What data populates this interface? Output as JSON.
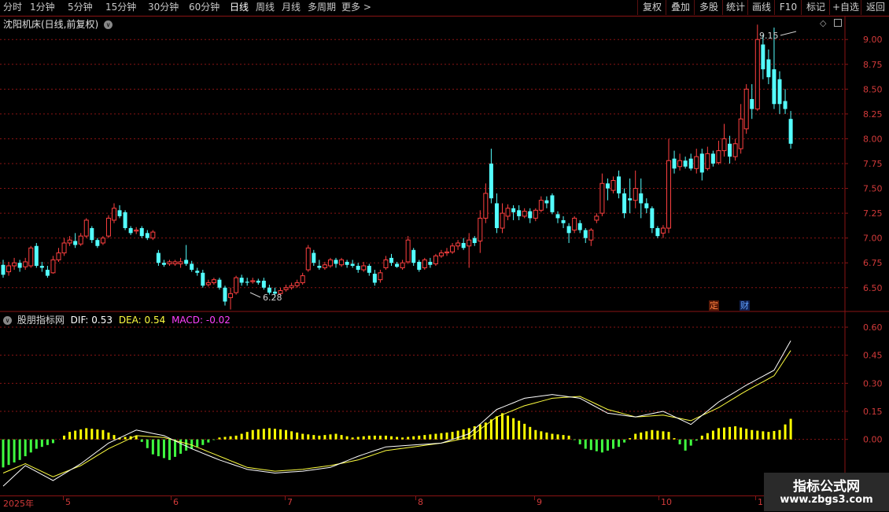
{
  "toolbar": {
    "periods": [
      "分时",
      "1分钟",
      "5分钟",
      "15分钟",
      "30分钟",
      "60分钟",
      "日线",
      "周线",
      "月线",
      "多周期",
      "更多 >"
    ],
    "active_period": "日线",
    "actions": [
      "复权",
      "叠加",
      "多股",
      "统计",
      "画线",
      "F10",
      "标记",
      "+自选",
      "返回"
    ]
  },
  "price_panel": {
    "title": "沈阳机床(日线,前复权)",
    "y_ticks": [
      "9.00",
      "8.75",
      "8.50",
      "8.25",
      "8.00",
      "7.75",
      "7.50",
      "7.25",
      "7.00",
      "6.75",
      "6.50"
    ],
    "high_marker": "9.15",
    "low_marker": "6.28",
    "badges": [
      "定",
      "财"
    ]
  },
  "macd_panel": {
    "indicator_name": "股朋指标网",
    "dif_label": "DIF: 0.53",
    "dea_label": "DEA: 0.54",
    "macd_label": "MACD: -0.02",
    "y_ticks": [
      "0.60",
      "0.45",
      "0.30",
      "0.15",
      "0.00"
    ]
  },
  "time_axis": {
    "ticks": [
      "2025年",
      "5",
      "6",
      "7",
      "8",
      "9",
      "10",
      "1"
    ]
  },
  "watermark": {
    "title": "指标公式网",
    "url": "www.zbgs3.com"
  },
  "colors": {
    "up": "#ff4040",
    "down": "#54ffff",
    "dif": "#ffffff",
    "dea": "#ffff40",
    "macd_pos": "#ffff00",
    "macd_neg": "#40ff40",
    "grid": "#8a1414"
  },
  "chart_data": [
    {
      "type": "candlestick",
      "title": "沈阳机床(日线,前复权)",
      "ylim": [
        6.3,
        9.2
      ],
      "y_ticks": [
        6.5,
        6.75,
        7.0,
        7.25,
        7.5,
        7.75,
        8.0,
        8.25,
        8.5,
        8.75,
        9.0
      ],
      "candles": [
        [
          6.73,
          6.63,
          6.78,
          6.6
        ],
        [
          6.66,
          6.72,
          6.76,
          6.62
        ],
        [
          6.72,
          6.75,
          6.8,
          6.68
        ],
        [
          6.75,
          6.7,
          6.78,
          6.66
        ],
        [
          6.71,
          6.76,
          6.8,
          6.68
        ],
        [
          6.72,
          6.9,
          6.92,
          6.7
        ],
        [
          6.92,
          6.72,
          6.95,
          6.7
        ],
        [
          6.72,
          6.7,
          6.76,
          6.66
        ],
        [
          6.68,
          6.62,
          6.72,
          6.6
        ],
        [
          6.65,
          6.78,
          6.82,
          6.64
        ],
        [
          6.78,
          6.85,
          6.9,
          6.76
        ],
        [
          6.85,
          6.95,
          7.0,
          6.82
        ],
        [
          6.95,
          6.98,
          7.02,
          6.92
        ],
        [
          6.97,
          6.93,
          7.05,
          6.9
        ],
        [
          6.94,
          7.02,
          7.05,
          6.92
        ],
        [
          7.02,
          7.18,
          7.2,
          7.0
        ],
        [
          7.1,
          6.98,
          7.12,
          6.95
        ],
        [
          6.98,
          6.92,
          7.0,
          6.9
        ],
        [
          6.95,
          7.0,
          7.02,
          6.93
        ],
        [
          7.02,
          7.2,
          7.23,
          7.0
        ],
        [
          7.18,
          7.3,
          7.35,
          7.15
        ],
        [
          7.28,
          7.22,
          7.33,
          7.2
        ],
        [
          7.26,
          7.1,
          7.28,
          7.08
        ],
        [
          7.1,
          7.05,
          7.12,
          7.03
        ],
        [
          7.07,
          7.08,
          7.11,
          7.04
        ],
        [
          7.1,
          7.02,
          7.12,
          7.0
        ],
        [
          7.05,
          7.0,
          7.08,
          6.98
        ],
        [
          7.0,
          7.06,
          7.08,
          6.98
        ],
        [
          6.85,
          6.75,
          6.88,
          6.72
        ],
        [
          6.75,
          6.73,
          6.78,
          6.71
        ],
        [
          6.74,
          6.76,
          6.78,
          6.72
        ],
        [
          6.74,
          6.76,
          6.78,
          6.72
        ],
        [
          6.74,
          6.76,
          6.8,
          6.7
        ],
        [
          6.78,
          6.74,
          6.93,
          6.72
        ],
        [
          6.74,
          6.68,
          6.77,
          6.66
        ],
        [
          6.67,
          6.65,
          6.7,
          6.62
        ],
        [
          6.65,
          6.52,
          6.68,
          6.5
        ],
        [
          6.53,
          6.55,
          6.58,
          6.51
        ],
        [
          6.55,
          6.58,
          6.6,
          6.53
        ],
        [
          6.58,
          6.5,
          6.6,
          6.48
        ],
        [
          6.5,
          6.36,
          6.52,
          6.32
        ],
        [
          6.4,
          6.44,
          6.5,
          6.28
        ],
        [
          6.45,
          6.6,
          6.62,
          6.43
        ],
        [
          6.6,
          6.55,
          6.63,
          6.52
        ],
        [
          6.56,
          6.55,
          6.6,
          6.52
        ],
        [
          6.56,
          6.57,
          6.6,
          6.54
        ],
        [
          6.57,
          6.55,
          6.59,
          6.53
        ],
        [
          6.57,
          6.5,
          6.6,
          6.48
        ],
        [
          6.5,
          6.45,
          6.53,
          6.43
        ],
        [
          6.46,
          6.44,
          6.5,
          6.4
        ],
        [
          6.44,
          6.47,
          6.5,
          6.42
        ],
        [
          6.48,
          6.5,
          6.53,
          6.46
        ],
        [
          6.5,
          6.52,
          6.55,
          6.48
        ],
        [
          6.52,
          6.55,
          6.58,
          6.5
        ],
        [
          6.55,
          6.62,
          6.65,
          6.53
        ],
        [
          6.68,
          6.9,
          6.93,
          6.66
        ],
        [
          6.85,
          6.75,
          6.88,
          6.72
        ],
        [
          6.72,
          6.7,
          6.78,
          6.68
        ],
        [
          6.7,
          6.73,
          6.76,
          6.68
        ],
        [
          6.72,
          6.78,
          6.8,
          6.7
        ],
        [
          6.78,
          6.74,
          6.8,
          6.7
        ],
        [
          6.73,
          6.78,
          6.8,
          6.71
        ],
        [
          6.76,
          6.73,
          6.78,
          6.7
        ],
        [
          6.74,
          6.72,
          6.78,
          6.7
        ],
        [
          6.72,
          6.68,
          6.75,
          6.65
        ],
        [
          6.68,
          6.72,
          6.76,
          6.66
        ],
        [
          6.72,
          6.65,
          6.74,
          6.62
        ],
        [
          6.64,
          6.55,
          6.68,
          6.52
        ],
        [
          6.58,
          6.65,
          6.68,
          6.55
        ],
        [
          6.7,
          6.78,
          6.82,
          6.68
        ],
        [
          6.8,
          6.75,
          6.84,
          6.72
        ],
        [
          6.74,
          6.71,
          6.76,
          6.7
        ],
        [
          6.7,
          6.75,
          6.78,
          6.68
        ],
        [
          6.76,
          6.98,
          7.02,
          6.74
        ],
        [
          6.88,
          6.75,
          6.9,
          6.72
        ],
        [
          6.76,
          6.68,
          6.78,
          6.66
        ],
        [
          6.7,
          6.78,
          6.8,
          6.68
        ],
        [
          6.76,
          6.73,
          6.8,
          6.7
        ],
        [
          6.74,
          6.82,
          6.84,
          6.72
        ],
        [
          6.82,
          6.85,
          6.88,
          6.8
        ],
        [
          6.85,
          6.86,
          6.9,
          6.82
        ],
        [
          6.86,
          6.92,
          6.95,
          6.84
        ],
        [
          6.92,
          6.95,
          6.98,
          6.88
        ],
        [
          6.95,
          6.9,
          7.0,
          6.88
        ],
        [
          6.92,
          6.98,
          7.05,
          6.7
        ],
        [
          7.0,
          6.95,
          7.02,
          6.92
        ],
        [
          6.97,
          7.2,
          7.28,
          6.85
        ],
        [
          7.2,
          7.45,
          7.55,
          7.15
        ],
        [
          7.75,
          7.4,
          7.9,
          7.35
        ],
        [
          7.35,
          7.1,
          7.45,
          7.05
        ],
        [
          7.1,
          7.25,
          7.35,
          7.05
        ],
        [
          7.22,
          7.3,
          7.34,
          7.18
        ],
        [
          7.3,
          7.26,
          7.33,
          7.18
        ],
        [
          7.28,
          7.22,
          7.33,
          7.18
        ],
        [
          7.22,
          7.27,
          7.3,
          7.2
        ],
        [
          7.27,
          7.2,
          7.3,
          7.15
        ],
        [
          7.2,
          7.28,
          7.3,
          7.17
        ],
        [
          7.28,
          7.38,
          7.42,
          7.26
        ],
        [
          7.38,
          7.35,
          7.42,
          7.3
        ],
        [
          7.43,
          7.26,
          7.45,
          7.24
        ],
        [
          7.24,
          7.2,
          7.27,
          7.15
        ],
        [
          7.18,
          7.15,
          7.22,
          7.1
        ],
        [
          7.12,
          7.05,
          7.15,
          6.95
        ],
        [
          7.08,
          7.2,
          7.22,
          7.05
        ],
        [
          7.15,
          7.08,
          7.18,
          7.05
        ],
        [
          7.08,
          7.0,
          7.1,
          6.95
        ],
        [
          6.98,
          7.08,
          7.1,
          6.92
        ],
        [
          7.18,
          7.22,
          7.25,
          7.15
        ],
        [
          7.25,
          7.55,
          7.65,
          7.22
        ],
        [
          7.55,
          7.5,
          7.6,
          7.38
        ],
        [
          7.48,
          7.58,
          7.62,
          7.45
        ],
        [
          7.62,
          7.45,
          7.68,
          7.4
        ],
        [
          7.45,
          7.25,
          7.5,
          7.2
        ],
        [
          7.4,
          7.38,
          7.6,
          7.25
        ],
        [
          7.38,
          7.5,
          7.68,
          7.3
        ],
        [
          7.45,
          7.35,
          7.6,
          7.2
        ],
        [
          7.35,
          7.3,
          7.4,
          7.25
        ],
        [
          7.3,
          7.1,
          7.32,
          7.05
        ],
        [
          7.1,
          7.02,
          7.12,
          7.0
        ],
        [
          7.05,
          7.1,
          7.13,
          7.0
        ],
        [
          7.1,
          7.78,
          8.0,
          7.05
        ],
        [
          7.8,
          7.7,
          7.88,
          7.65
        ],
        [
          7.72,
          7.78,
          7.85,
          7.68
        ],
        [
          7.78,
          7.72,
          7.82,
          7.7
        ],
        [
          7.8,
          7.7,
          7.85,
          7.68
        ],
        [
          7.7,
          7.82,
          7.9,
          7.65
        ],
        [
          7.85,
          7.66,
          7.9,
          7.58
        ],
        [
          7.7,
          7.85,
          7.92,
          7.68
        ],
        [
          7.85,
          7.75,
          7.88,
          7.72
        ],
        [
          7.76,
          7.88,
          7.98,
          7.74
        ],
        [
          7.88,
          8.0,
          8.15,
          7.82
        ],
        [
          7.95,
          7.82,
          8.03,
          7.75
        ],
        [
          7.82,
          7.95,
          8.0,
          7.78
        ],
        [
          7.9,
          8.2,
          8.35,
          7.85
        ],
        [
          8.1,
          8.5,
          8.55,
          8.05
        ],
        [
          8.4,
          8.3,
          8.55,
          8.2
        ],
        [
          8.3,
          9.0,
          9.15,
          8.28
        ],
        [
          8.95,
          8.7,
          9.05,
          8.6
        ],
        [
          8.8,
          8.62,
          8.9,
          8.55
        ],
        [
          8.7,
          8.35,
          9.12,
          8.3
        ],
        [
          8.6,
          8.35,
          8.68,
          8.25
        ],
        [
          8.38,
          8.3,
          8.5,
          8.25
        ],
        [
          8.2,
          7.95,
          8.28,
          7.9
        ]
      ]
    },
    {
      "type": "line+bar",
      "title": "股朋指标网",
      "ylim": [
        -0.3,
        0.68
      ],
      "y_ticks": [
        0.0,
        0.15,
        0.3,
        0.45,
        0.6
      ],
      "series": [
        {
          "name": "DIF",
          "x": [
            0,
            4,
            9,
            14,
            19,
            24,
            29,
            34,
            39,
            44,
            49,
            54,
            59,
            64,
            69,
            74,
            79,
            84,
            89,
            94,
            99,
            104,
            109,
            114,
            119,
            124,
            129,
            134,
            139,
            143,
            146
          ],
          "values": [
            -0.25,
            -0.14,
            -0.22,
            -0.13,
            -0.02,
            0.05,
            0.02,
            -0.05,
            -0.11,
            -0.16,
            -0.18,
            -0.17,
            -0.15,
            -0.09,
            -0.04,
            -0.03,
            -0.02,
            0.03,
            0.16,
            0.22,
            0.24,
            0.22,
            0.14,
            0.12,
            0.15,
            0.08,
            0.2,
            0.29,
            0.37,
            0.58,
            0.53
          ]
        },
        {
          "name": "DEA",
          "x": [
            0,
            4,
            9,
            14,
            19,
            24,
            29,
            34,
            39,
            44,
            49,
            54,
            59,
            64,
            69,
            74,
            79,
            84,
            89,
            94,
            99,
            104,
            109,
            114,
            119,
            124,
            129,
            134,
            139,
            143,
            146
          ],
          "values": [
            -0.18,
            -0.13,
            -0.2,
            -0.14,
            -0.05,
            0.02,
            0.01,
            -0.03,
            -0.09,
            -0.15,
            -0.17,
            -0.16,
            -0.14,
            -0.11,
            -0.06,
            -0.04,
            -0.02,
            0.01,
            0.12,
            0.18,
            0.22,
            0.23,
            0.16,
            0.12,
            0.13,
            0.1,
            0.17,
            0.26,
            0.34,
            0.52,
            0.54
          ]
        },
        {
          "name": "MACD",
          "x": [
            0,
            3,
            6,
            9,
            12,
            15,
            18,
            21,
            24,
            27,
            30,
            33,
            36,
            39,
            42,
            45,
            48,
            51,
            54,
            57,
            60,
            63,
            66,
            69,
            72,
            75,
            78,
            81,
            84,
            87,
            90,
            93,
            96,
            99,
            102,
            105,
            108,
            111,
            114,
            117,
            120,
            123,
            126,
            129,
            132,
            135,
            138,
            140,
            142,
            144,
            146
          ],
          "values": [
            -0.15,
            -0.11,
            -0.05,
            -0.02,
            0.04,
            0.06,
            0.05,
            0.01,
            0.02,
            -0.08,
            -0.11,
            -0.06,
            -0.03,
            0.01,
            0.02,
            0.05,
            0.06,
            0.05,
            0.03,
            0.02,
            0.03,
            0.01,
            0.02,
            0.02,
            0.01,
            0.02,
            0.03,
            0.04,
            0.06,
            0.09,
            0.14,
            0.1,
            0.05,
            0.03,
            0.02,
            -0.05,
            -0.07,
            -0.04,
            0.03,
            0.05,
            0.04,
            -0.06,
            0.02,
            0.06,
            0.07,
            0.05,
            0.04,
            0.05,
            0.11,
            0.15,
            -0.02
          ]
        }
      ]
    }
  ]
}
